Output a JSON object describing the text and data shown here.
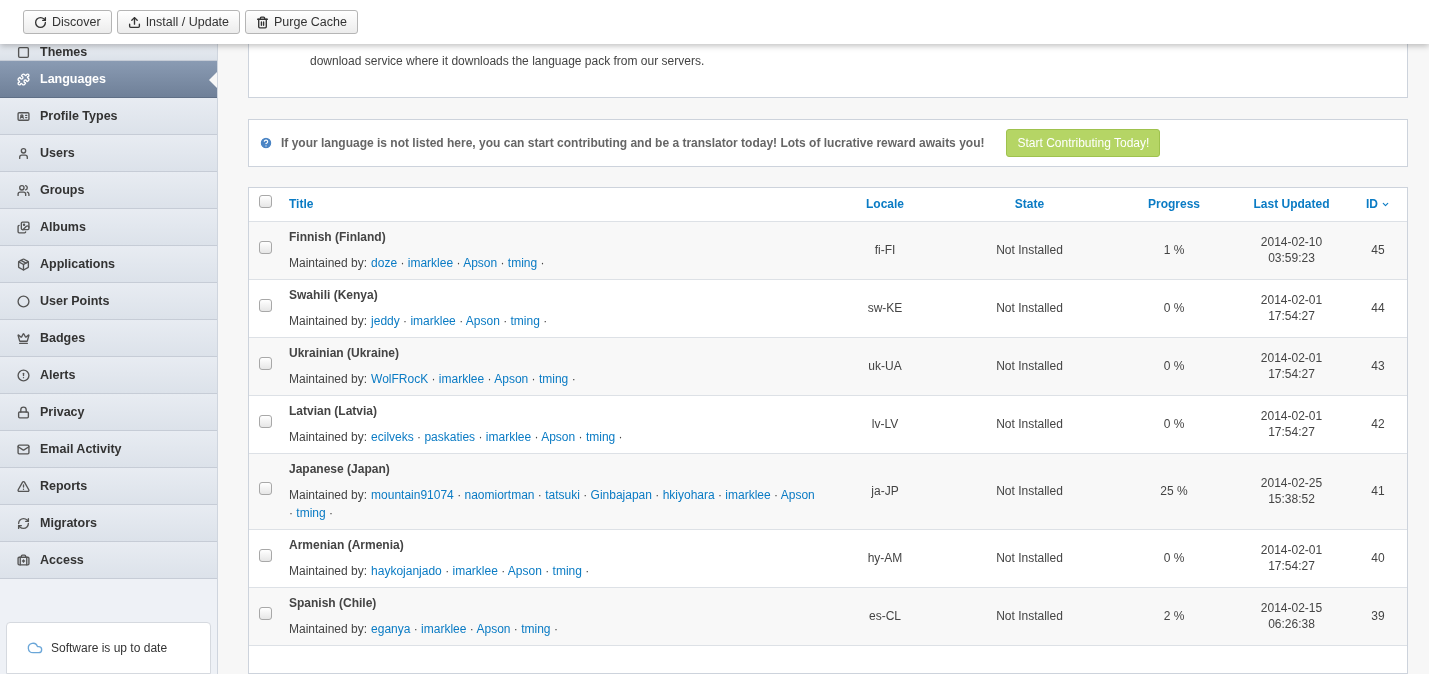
{
  "toolbar": {
    "buttons": [
      {
        "label": "Discover",
        "kind": "refresh"
      },
      {
        "label": "Install / Update",
        "kind": "upload"
      },
      {
        "label": "Purge Cache",
        "kind": "trash"
      }
    ]
  },
  "sidebar": {
    "items": [
      {
        "label": "Themes",
        "selected": false
      },
      {
        "label": "Languages",
        "selected": true
      },
      {
        "label": "Profile Types",
        "selected": false
      },
      {
        "label": "Users",
        "selected": false
      },
      {
        "label": "Groups",
        "selected": false
      },
      {
        "label": "Albums",
        "selected": false
      },
      {
        "label": "Applications",
        "selected": false
      },
      {
        "label": "User Points",
        "selected": false
      },
      {
        "label": "Badges",
        "selected": false
      },
      {
        "label": "Alerts",
        "selected": false
      },
      {
        "label": "Privacy",
        "selected": false
      },
      {
        "label": "Email Activity",
        "selected": false
      },
      {
        "label": "Reports",
        "selected": false
      },
      {
        "label": "Migrators",
        "selected": false
      },
      {
        "label": "Access",
        "selected": false
      }
    ],
    "status": "Software is up to date"
  },
  "intro": "download service where it downloads the language pack from our servers.",
  "notice": {
    "text": "If your language is not listed here, you can start contributing and be a translator today! Lots of lucrative reward awaits you!",
    "button": "Start Contributing Today!"
  },
  "table": {
    "select_all": {
      "checked": false
    },
    "columns": [
      {
        "label": "Title",
        "sorted": false
      },
      {
        "label": "Locale",
        "sorted": false
      },
      {
        "label": "State",
        "sorted": false
      },
      {
        "label": "Progress",
        "sorted": false
      },
      {
        "label": "Last Updated",
        "sorted": false
      },
      {
        "label": "ID",
        "sorted": true
      }
    ],
    "rows": [
      {
        "checked": false,
        "title": "Finnish (Finland)",
        "maintained_label": "Maintained by:",
        "maintainers": [
          {
            "name": "doze",
            "sep": "·"
          },
          {
            "name": "imarklee",
            "sep": "·"
          },
          {
            "name": "Apson",
            "sep": "·"
          },
          {
            "name": "tming",
            "sep": "·"
          }
        ],
        "locale": "fi-FI",
        "state": "Not Installed",
        "progress": "1 %",
        "date": "2014-02-10",
        "time": "03:59:23",
        "id": "45"
      },
      {
        "checked": false,
        "title": "Swahili (Kenya)",
        "maintained_label": "Maintained by:",
        "maintainers": [
          {
            "name": "jeddy",
            "sep": "·"
          },
          {
            "name": "imarklee",
            "sep": "·"
          },
          {
            "name": "Apson",
            "sep": "·"
          },
          {
            "name": "tming",
            "sep": "·"
          }
        ],
        "locale": "sw-KE",
        "state": "Not Installed",
        "progress": "0 %",
        "date": "2014-02-01",
        "time": "17:54:27",
        "id": "44"
      },
      {
        "checked": false,
        "title": "Ukrainian (Ukraine)",
        "maintained_label": "Maintained by:",
        "maintainers": [
          {
            "name": "WolFRocK",
            "sep": "·"
          },
          {
            "name": "imarklee",
            "sep": "·"
          },
          {
            "name": "Apson",
            "sep": "·"
          },
          {
            "name": "tming",
            "sep": "·"
          }
        ],
        "locale": "uk-UA",
        "state": "Not Installed",
        "progress": "0 %",
        "date": "2014-02-01",
        "time": "17:54:27",
        "id": "43"
      },
      {
        "checked": false,
        "title": "Latvian (Latvia)",
        "maintained_label": "Maintained by:",
        "maintainers": [
          {
            "name": "ecilveks",
            "sep": "·"
          },
          {
            "name": "paskaties",
            "sep": "·"
          },
          {
            "name": "imarklee",
            "sep": "·"
          },
          {
            "name": "Apson",
            "sep": "·"
          },
          {
            "name": "tming",
            "sep": "·"
          }
        ],
        "locale": "lv-LV",
        "state": "Not Installed",
        "progress": "0 %",
        "date": "2014-02-01",
        "time": "17:54:27",
        "id": "42"
      },
      {
        "checked": false,
        "title": "Japanese (Japan)",
        "maintained_label": "Maintained by:",
        "maintainers": [
          {
            "name": "mountain91074",
            "sep": "·"
          },
          {
            "name": "naomiortman",
            "sep": "·"
          },
          {
            "name": "tatsuki",
            "sep": "·"
          },
          {
            "name": "Ginbajapan",
            "sep": "·"
          },
          {
            "name": "hkiyohara",
            "sep": "·"
          },
          {
            "name": "imarklee",
            "sep": "·"
          },
          {
            "name": "Apson",
            "sep": "·"
          },
          {
            "name": "tming",
            "sep": "·"
          }
        ],
        "locale": "ja-JP",
        "state": "Not Installed",
        "progress": "25 %",
        "date": "2014-02-25",
        "time": "15:38:52",
        "id": "41"
      },
      {
        "checked": false,
        "title": "Armenian (Armenia)",
        "maintained_label": "Maintained by:",
        "maintainers": [
          {
            "name": "haykojanjado",
            "sep": "·"
          },
          {
            "name": "imarklee",
            "sep": "·"
          },
          {
            "name": "Apson",
            "sep": "·"
          },
          {
            "name": "tming",
            "sep": "·"
          }
        ],
        "locale": "hy-AM",
        "state": "Not Installed",
        "progress": "0 %",
        "date": "2014-02-01",
        "time": "17:54:27",
        "id": "40"
      },
      {
        "checked": false,
        "title": "Spanish (Chile)",
        "maintained_label": "Maintained by:",
        "maintainers": [
          {
            "name": "eganya",
            "sep": "·"
          },
          {
            "name": "imarklee",
            "sep": "·"
          },
          {
            "name": "Apson",
            "sep": "·"
          },
          {
            "name": "tming",
            "sep": "·"
          }
        ],
        "locale": "es-CL",
        "state": "Not Installed",
        "progress": "2 %",
        "date": "2014-02-15",
        "time": "06:26:38",
        "id": "39"
      }
    ]
  }
}
